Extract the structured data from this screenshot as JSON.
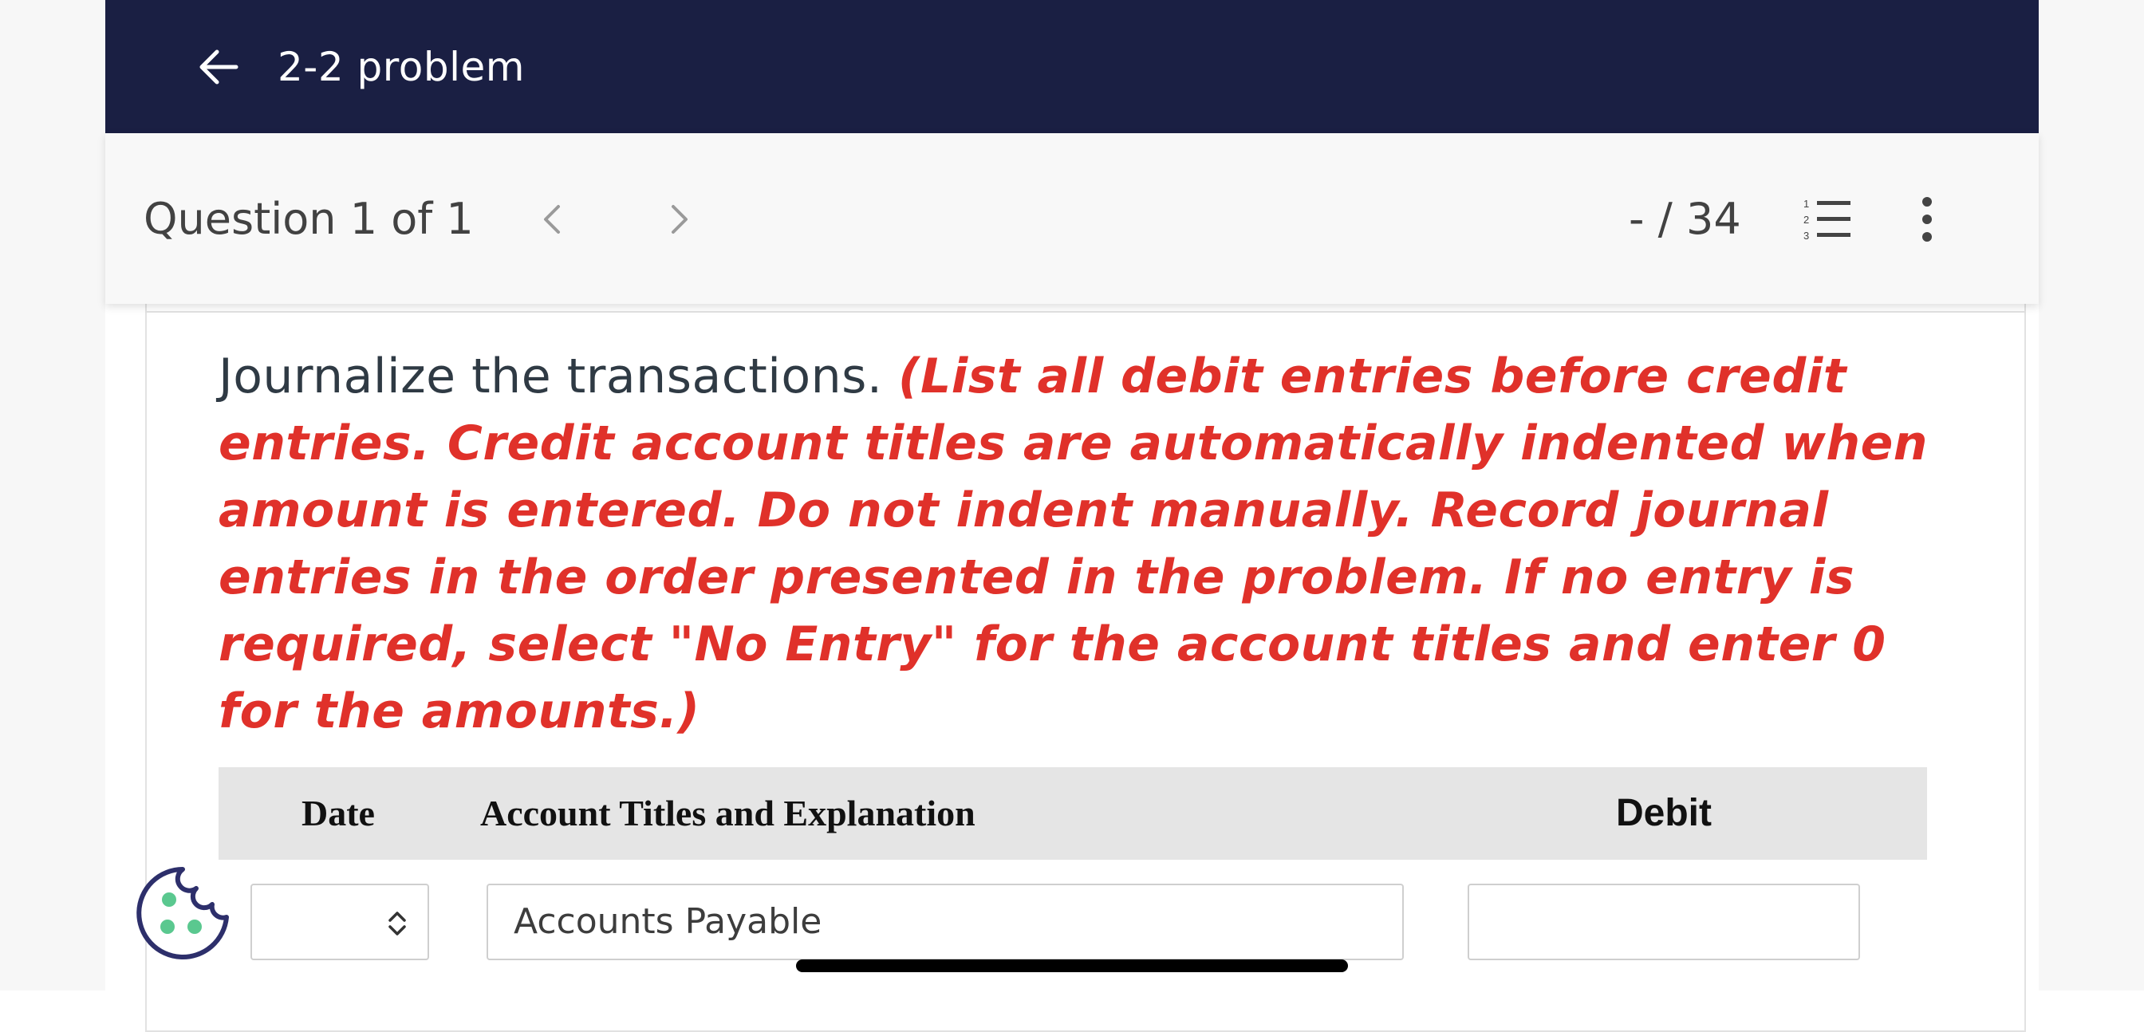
{
  "header": {
    "title": "2-2 problem",
    "back_icon": "arrow-left-icon",
    "background_color": "#1a1f43"
  },
  "question_nav": {
    "label": "Question 1 of 1",
    "prev_icon": "chevron-left-icon",
    "next_icon": "chevron-right-icon",
    "score": "- / 34",
    "list_icon": "numbered-list-icon",
    "more_icon": "more-vertical-icon"
  },
  "instructions": {
    "lead": "Journalize the transactions.",
    "note": "(List all debit entries before credit entries. Credit account titles are automatically indented when amount is entered. Do not indent manually. Record journal entries in the order presented in the problem. If no entry is required, select \"No Entry\" for the account titles and enter 0 for the amounts.)",
    "note_color": "#e0312a"
  },
  "journal_table": {
    "columns": {
      "date": "Date",
      "account": "Account Titles and Explanation",
      "debit": "Debit"
    },
    "rows": [
      {
        "date_value": "",
        "account_value": "Accounts Payable",
        "debit_value": ""
      }
    ]
  },
  "cookie_icon": "cookie-icon"
}
